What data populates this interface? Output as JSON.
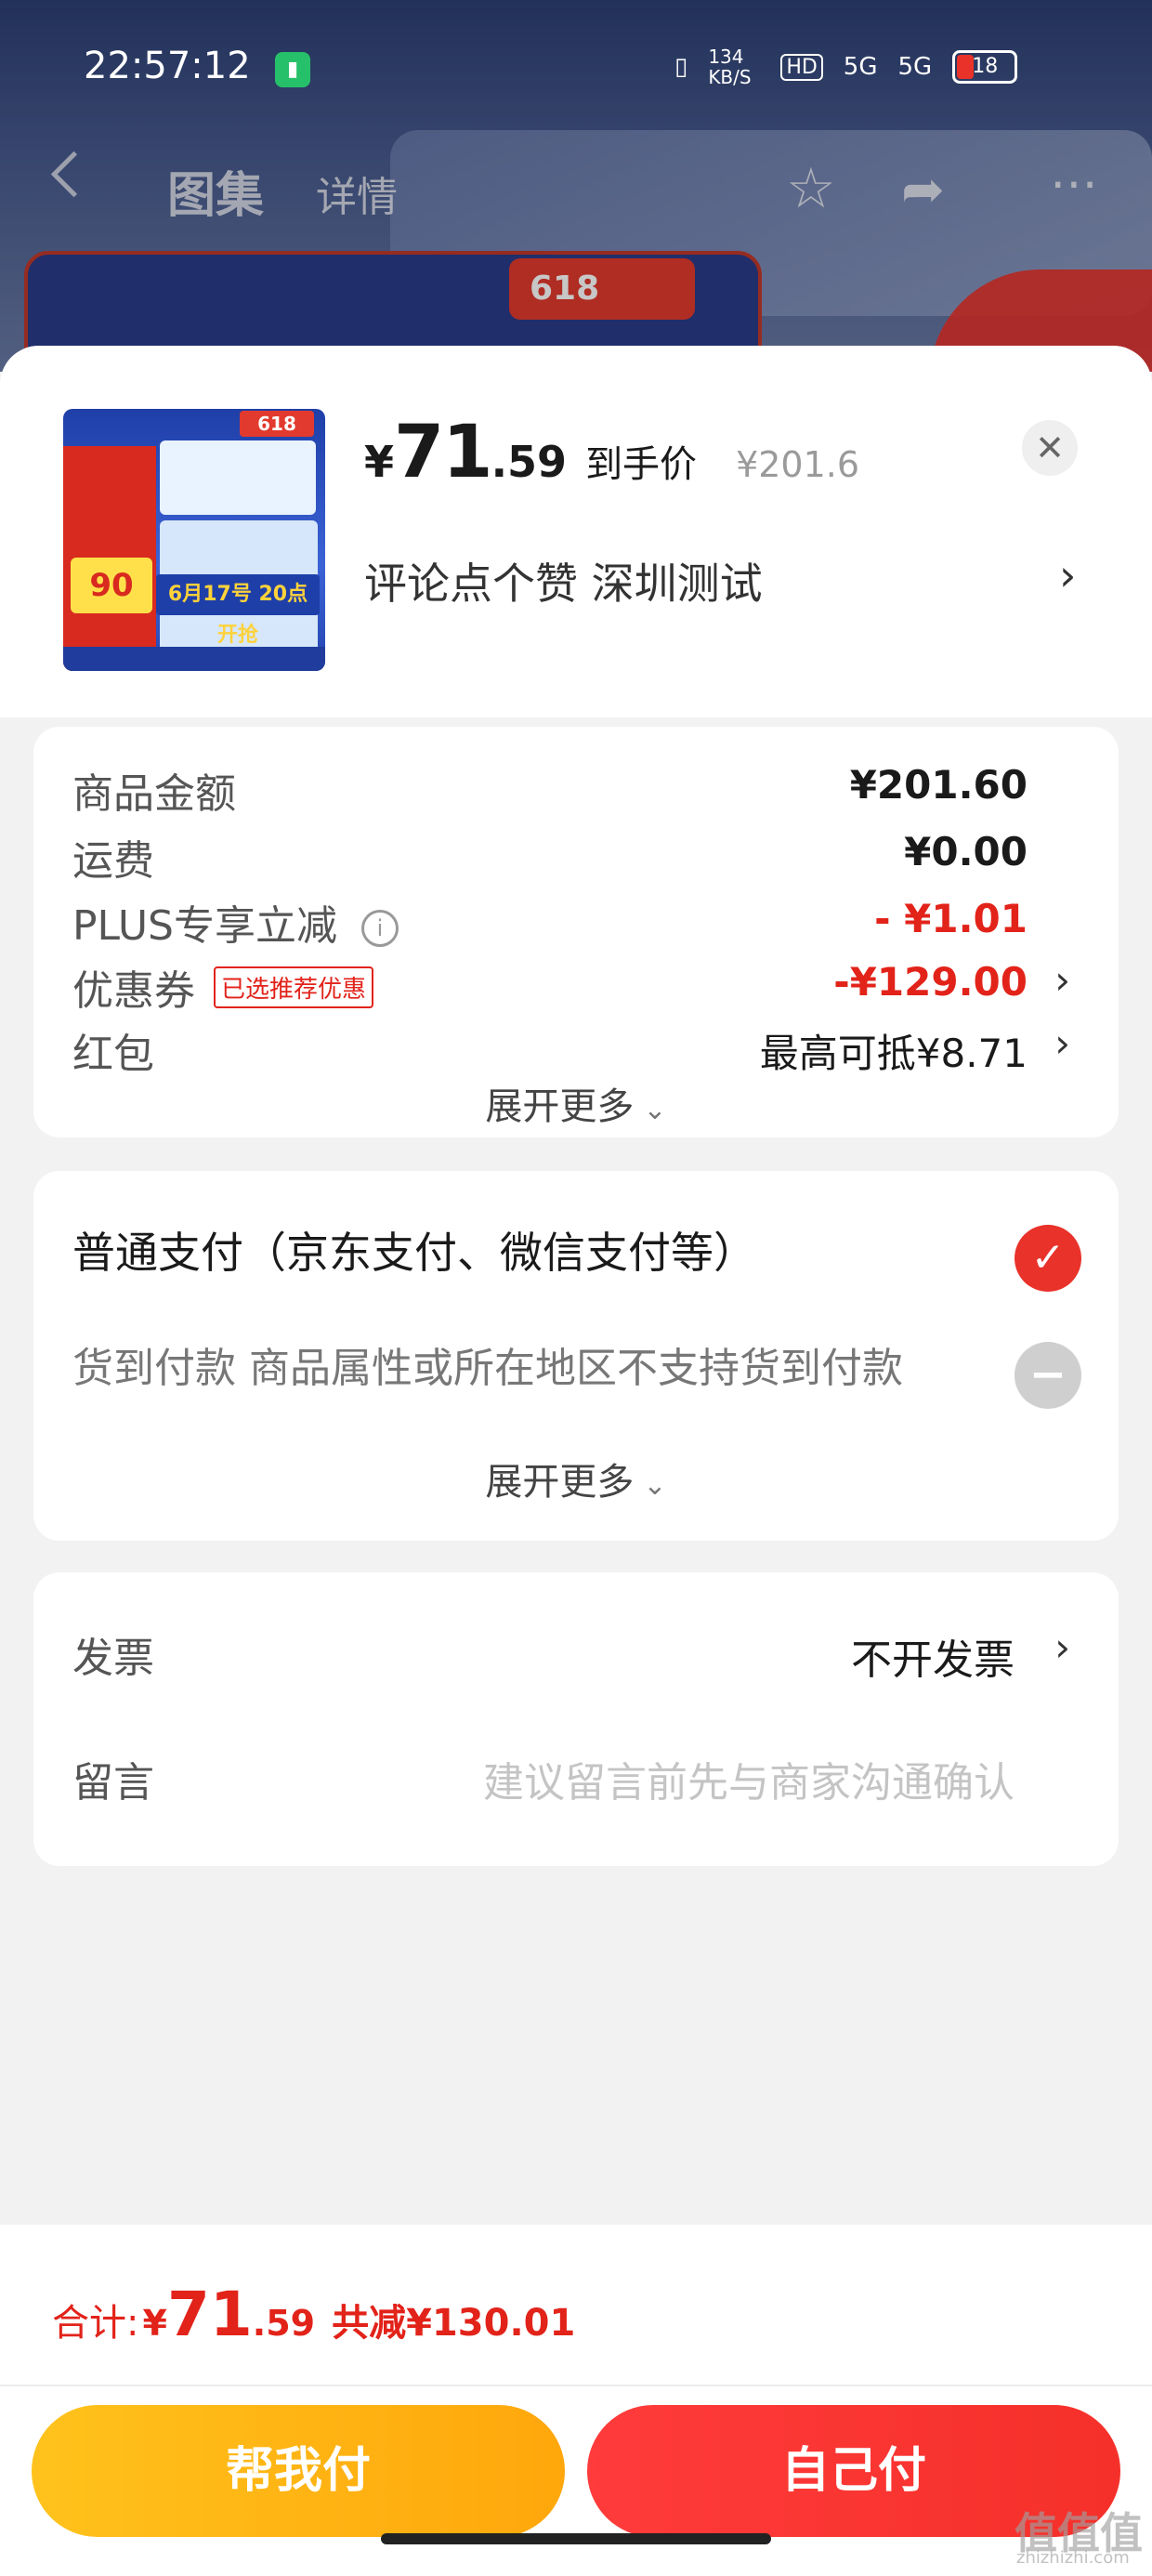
{
  "status_bar": {
    "time": "22:57:12",
    "network_speed": "134 KB/S",
    "hd": "HD",
    "signal1": "5G",
    "signal2": "5G",
    "battery": "18"
  },
  "background_nav": {
    "tab_gallery": "图集",
    "tab_detail": "详情",
    "badge_618": "618"
  },
  "header": {
    "currency": "¥",
    "price_integer": "71",
    "price_decimal": ".59",
    "price_tag": "到手价",
    "original_price": "¥201.6",
    "product_name": "评论点个赞  深圳测试",
    "thumbnail": {
      "badge": "618",
      "date_text": "6月17号 20点 开抢",
      "price_text": "90"
    }
  },
  "summary": {
    "rows": [
      {
        "label": "商品金额",
        "value": "¥201.60"
      },
      {
        "label": "运费",
        "value": "¥0.00"
      },
      {
        "label": "PLUS专享立减",
        "value": "- ¥1.01"
      },
      {
        "label": "优惠券",
        "badge": "已选推荐优惠",
        "value": "-¥129.00"
      },
      {
        "label": "红包",
        "value": "最高可抵¥8.71"
      }
    ],
    "expand_label": "展开更多"
  },
  "payment": {
    "options": [
      {
        "label": "普通支付（京东支付、微信支付等）",
        "selected": true
      },
      {
        "label": "货到付款 商品属性或所在地区不支持货到付款",
        "selected": false
      }
    ],
    "expand_label": "展开更多"
  },
  "extras": {
    "invoice_label": "发票",
    "invoice_value": "不开发票",
    "message_label": "留言",
    "message_placeholder": "建议留言前先与商家沟通确认"
  },
  "footer": {
    "total_label": "合计:",
    "total_currency": "¥",
    "total_integer": "71",
    "total_decimal": ".59",
    "total_saved": "共减¥130.01",
    "help_pay_button": "帮我付",
    "self_pay_button": "自己付"
  },
  "watermark": {
    "main": "值值值",
    "sub": "zhizhizhi.com"
  },
  "colors": {
    "accent_red": "#e2231a",
    "help_yellow": "#ffb316",
    "self_red": "#f5302a"
  }
}
